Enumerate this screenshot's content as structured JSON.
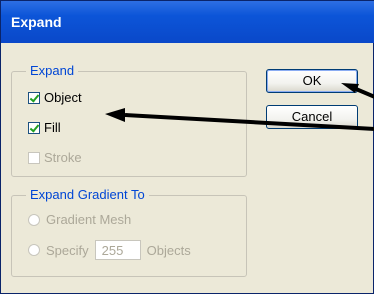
{
  "window": {
    "title": "Expand"
  },
  "expand_group": {
    "legend": "Expand",
    "object": {
      "label": "Object",
      "checked": true
    },
    "fill": {
      "label": "Fill",
      "checked": true
    },
    "stroke": {
      "label": "Stroke",
      "checked": false,
      "enabled": false
    }
  },
  "gradient_group": {
    "legend": "Expand Gradient To",
    "gradient_mesh_label": "Gradient Mesh",
    "specify_label": "Specify",
    "objects_value": "255",
    "objects_label": "Objects"
  },
  "buttons": {
    "ok_label": "OK",
    "cancel_label": "Cancel"
  },
  "colors": {
    "title_bar": "#0a48c9",
    "group_legend": "#0046d5",
    "dialog_background": "#ece9d8",
    "disabled_text": "#aca899"
  }
}
